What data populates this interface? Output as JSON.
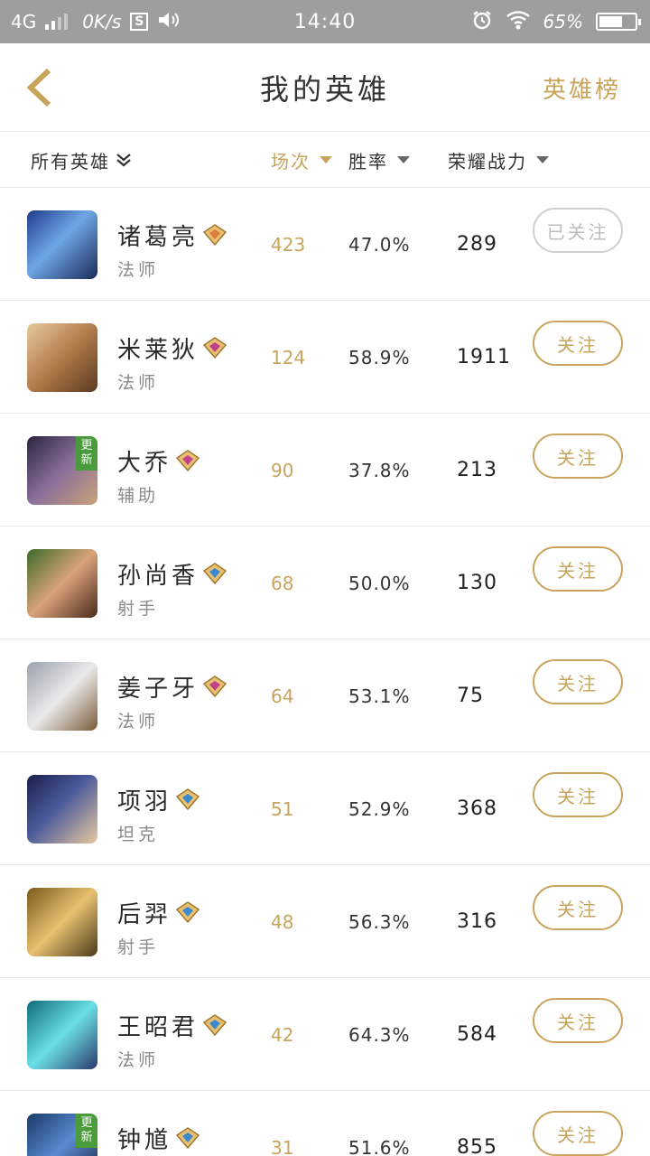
{
  "statusbar": {
    "network": "4G",
    "speed": "0K/s",
    "s_icon": "S",
    "time": "14:40",
    "battery": "65%",
    "battery_level": 0.65
  },
  "header": {
    "title": "我的英雄",
    "right_link": "英雄榜"
  },
  "filters": {
    "all_heroes": "所有英雄",
    "matches": "场次",
    "win_rate": "胜率",
    "glory_power": "荣耀战力"
  },
  "colors": {
    "accent": "#c8a45c",
    "statusbar_bg": "#9e9e9e",
    "badge_green": "#4a9b3c"
  },
  "heroes": [
    {
      "name": "诸葛亮",
      "role": "法师",
      "matches": "423",
      "win_rate": "47.0%",
      "power": "289",
      "follow": "已关注",
      "followed": true,
      "badge": "",
      "gem": "orange"
    },
    {
      "name": "米莱狄",
      "role": "法师",
      "matches": "124",
      "win_rate": "58.9%",
      "power": "1911",
      "follow": "关注",
      "followed": false,
      "badge": "",
      "gem": "pink"
    },
    {
      "name": "大乔",
      "role": "辅助",
      "matches": "90",
      "win_rate": "37.8%",
      "power": "213",
      "follow": "关注",
      "followed": false,
      "badge": "更新",
      "gem": "pink"
    },
    {
      "name": "孙尚香",
      "role": "射手",
      "matches": "68",
      "win_rate": "50.0%",
      "power": "130",
      "follow": "关注",
      "followed": false,
      "badge": "",
      "gem": "blue"
    },
    {
      "name": "姜子牙",
      "role": "法师",
      "matches": "64",
      "win_rate": "53.1%",
      "power": "75",
      "follow": "关注",
      "followed": false,
      "badge": "",
      "gem": "pink"
    },
    {
      "name": "项羽",
      "role": "坦克",
      "matches": "51",
      "win_rate": "52.9%",
      "power": "368",
      "follow": "关注",
      "followed": false,
      "badge": "",
      "gem": "blue"
    },
    {
      "name": "后羿",
      "role": "射手",
      "matches": "48",
      "win_rate": "56.3%",
      "power": "316",
      "follow": "关注",
      "followed": false,
      "badge": "",
      "gem": "blue"
    },
    {
      "name": "王昭君",
      "role": "法师",
      "matches": "42",
      "win_rate": "64.3%",
      "power": "584",
      "follow": "关注",
      "followed": false,
      "badge": "",
      "gem": "blue"
    },
    {
      "name": "钟馗",
      "role": "",
      "matches": "31",
      "win_rate": "51.6%",
      "power": "855",
      "follow": "关注",
      "followed": false,
      "badge": "更新",
      "gem": "blue"
    }
  ]
}
